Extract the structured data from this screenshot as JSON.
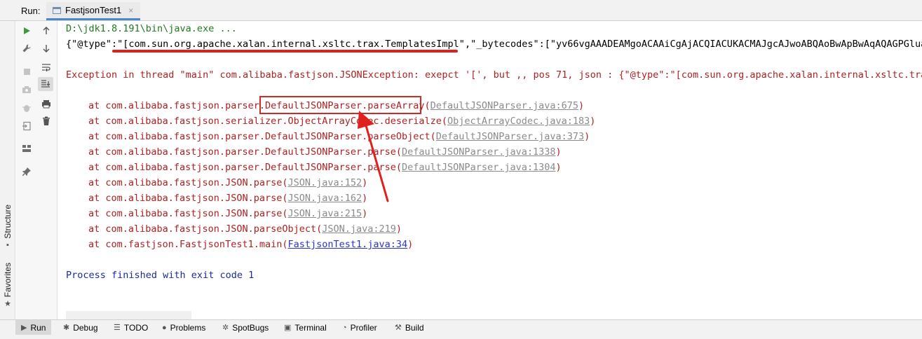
{
  "run_header": {
    "label": "Run:",
    "tab_label": "FastjsonTest1",
    "tab_close": "×"
  },
  "side": {
    "structure_label": "Structure",
    "favorites_label": "Favorites"
  },
  "console": {
    "command_line": "D:\\jdk1.8.191\\bin\\java.exe ...",
    "json_line": "{\"@type\":\"[com.sun.org.apache.xalan.internal.xsltc.trax.TemplatesImpl\",\"_bytecodes\":[\"yv66vgAAADEAMgoACAAiCgAjACQIACUKACMAJgcAJwoABQAoBwApBwAqAQAGPGluaXQ+",
    "exception_line": "Exception in thread \"main\" com.alibaba.fastjson.JSONException: exepct '[', but ,, pos 71, json : {\"@type\":\"[com.sun.org.apache.xalan.internal.xsltc.trax",
    "frames": [
      {
        "text": "at com.alibaba.fastjson.parser.DefaultJSONParser.parseArray(",
        "link": "DefaultJSONParser.java:675",
        "tail": ")"
      },
      {
        "text": "at com.alibaba.fastjson.serializer.ObjectArrayCodec.deserialze(",
        "link": "ObjectArrayCodec.java:183",
        "tail": ")"
      },
      {
        "text": "at com.alibaba.fastjson.parser.DefaultJSONParser.parseObject(",
        "link": "DefaultJSONParser.java:373",
        "tail": ")"
      },
      {
        "text": "at com.alibaba.fastjson.parser.DefaultJSONParser.parse(",
        "link": "DefaultJSONParser.java:1338",
        "tail": ")"
      },
      {
        "text": "at com.alibaba.fastjson.parser.DefaultJSONParser.parse(",
        "link": "DefaultJSONParser.java:1304",
        "tail": ")"
      },
      {
        "text": "at com.alibaba.fastjson.JSON.parse(",
        "link": "JSON.java:152",
        "tail": ")"
      },
      {
        "text": "at com.alibaba.fastjson.JSON.parse(",
        "link": "JSON.java:162",
        "tail": ")"
      },
      {
        "text": "at com.alibaba.fastjson.JSON.parse(",
        "link": "JSON.java:215",
        "tail": ")"
      },
      {
        "text": "at com.alibaba.fastjson.JSON.parseObject(",
        "link": "JSON.java:219",
        "tail": ")"
      },
      {
        "text": "at com.fastjson.FastjsonTest1.main(",
        "link": "FastjsonTest1.java:34",
        "tail": ")"
      }
    ],
    "finish_line": "Process finished with exit code 1"
  },
  "bottom_tabs": {
    "run": "Run",
    "debug": "Debug",
    "todo": "TODO",
    "problems": "Problems",
    "spotbugs": "SpotBugs",
    "terminal": "Terminal",
    "profiler": "Profiler",
    "build": "Build"
  },
  "colors": {
    "command": "#1f7a1f",
    "error": "#b02020",
    "info": "#1a2a9a",
    "annotation": "#e0201c",
    "link_user": "#2a35c8",
    "link_lib": "#8a8a8a"
  }
}
